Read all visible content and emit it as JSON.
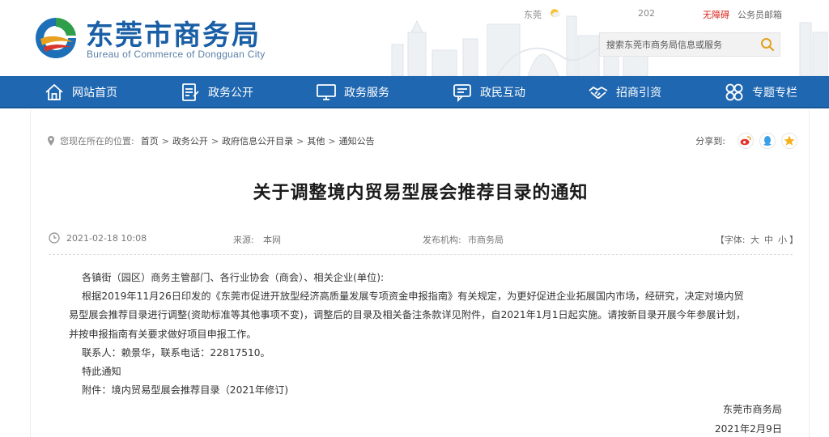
{
  "header": {
    "site_name_cn": "东莞市商务局",
    "site_name_en": "Bureau of Commerce of Dongguan City",
    "weather_city": "东莞",
    "weather_year": "202",
    "barrier_free": "无障碍",
    "staff_mail": "公务员邮箱",
    "search_placeholder": "搜索东莞市商务局信息或服务"
  },
  "nav": [
    {
      "label": "网站首页",
      "icon": "home-icon"
    },
    {
      "label": "政务公开",
      "icon": "document-icon"
    },
    {
      "label": "政务服务",
      "icon": "monitor-icon"
    },
    {
      "label": "政民互动",
      "icon": "chat-icon"
    },
    {
      "label": "招商引资",
      "icon": "handshake-icon"
    },
    {
      "label": "专题专栏",
      "icon": "grid-icon"
    }
  ],
  "breadcrumb": {
    "prefix": "您现在所在的位置:",
    "items": [
      "首页",
      "政务公开",
      "政府信息公开目录",
      "其他",
      "通知公告"
    ],
    "separator": ">"
  },
  "share": {
    "label": "分享到:",
    "targets": [
      "weibo-icon",
      "qq-icon",
      "qzone-icon"
    ]
  },
  "article": {
    "title": "关于调整境内贸易型展会推荐目录的通知",
    "date": "2021-02-18 10:08",
    "source_label": "来源:",
    "source": "本网",
    "publisher_label": "发布机构:",
    "publisher": "市商务局",
    "font_size_label_open": "【字体:",
    "font_sizes": [
      "大",
      "中",
      "小"
    ],
    "font_size_label_close": "】",
    "paragraphs": [
      "各镇街（园区）商务主管部门、各行业协会（商会）、相关企业(单位):",
      "根据2019年11月26日印发的《东莞市促进开放型经济高质量发展专项资金申报指南》有关规定，为更好促进企业拓展国内市场，经研究，决定对境内贸",
      "易型展会推荐目录进行调整(资助标准等其他事项不变)，调整后的目录及相关备注条款详见附件，自2021年1月1日起实施。请按新目录开展今年参展计划，",
      "并按申报指南有关要求做好项目申报工作。",
      "联系人：赖景华，联系电话：22817510。",
      "特此通知",
      "附件：境内贸易型展会推荐目录（2021年修订)"
    ],
    "signature": "东莞市商务局",
    "sign_date": "2021年2月9日"
  },
  "colors": {
    "nav_bg": "#1f67b1",
    "brand_blue": "#1a5fa6",
    "accent_red": "#d9251c"
  }
}
